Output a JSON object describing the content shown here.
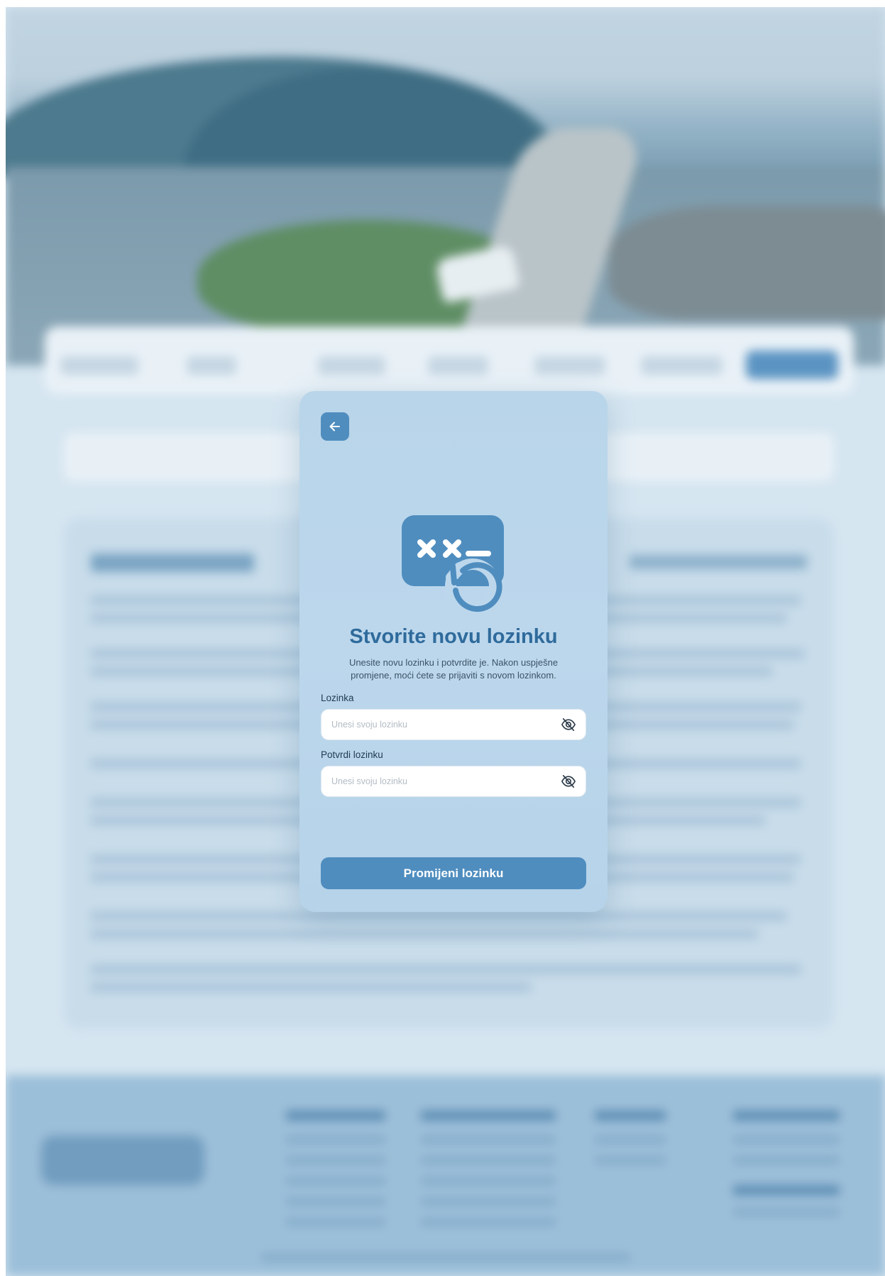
{
  "modal": {
    "title": "Stvorite novu lozinku",
    "subtitle": "Unesite novu lozinku i potvrdite je. Nakon uspješne promjene, moći ćete se prijaviti s novom lozinkom.",
    "password": {
      "label": "Lozinka",
      "placeholder": "Unesi svoju lozinku",
      "value": ""
    },
    "confirm_password": {
      "label": "Potvrdi lozinku",
      "placeholder": "Unesi svoju lozinku",
      "value": ""
    },
    "submit_label": "Promijeni lozinku",
    "icons": {
      "back": "arrow-left-icon",
      "illustration": "password-reset-icon",
      "visibility": "eye-off-icon"
    }
  },
  "colors": {
    "accent": "#4f8dbf",
    "title": "#2f6b9c",
    "modal_bg": "#bcd7ec",
    "page_bg": "#d6e6f1"
  }
}
